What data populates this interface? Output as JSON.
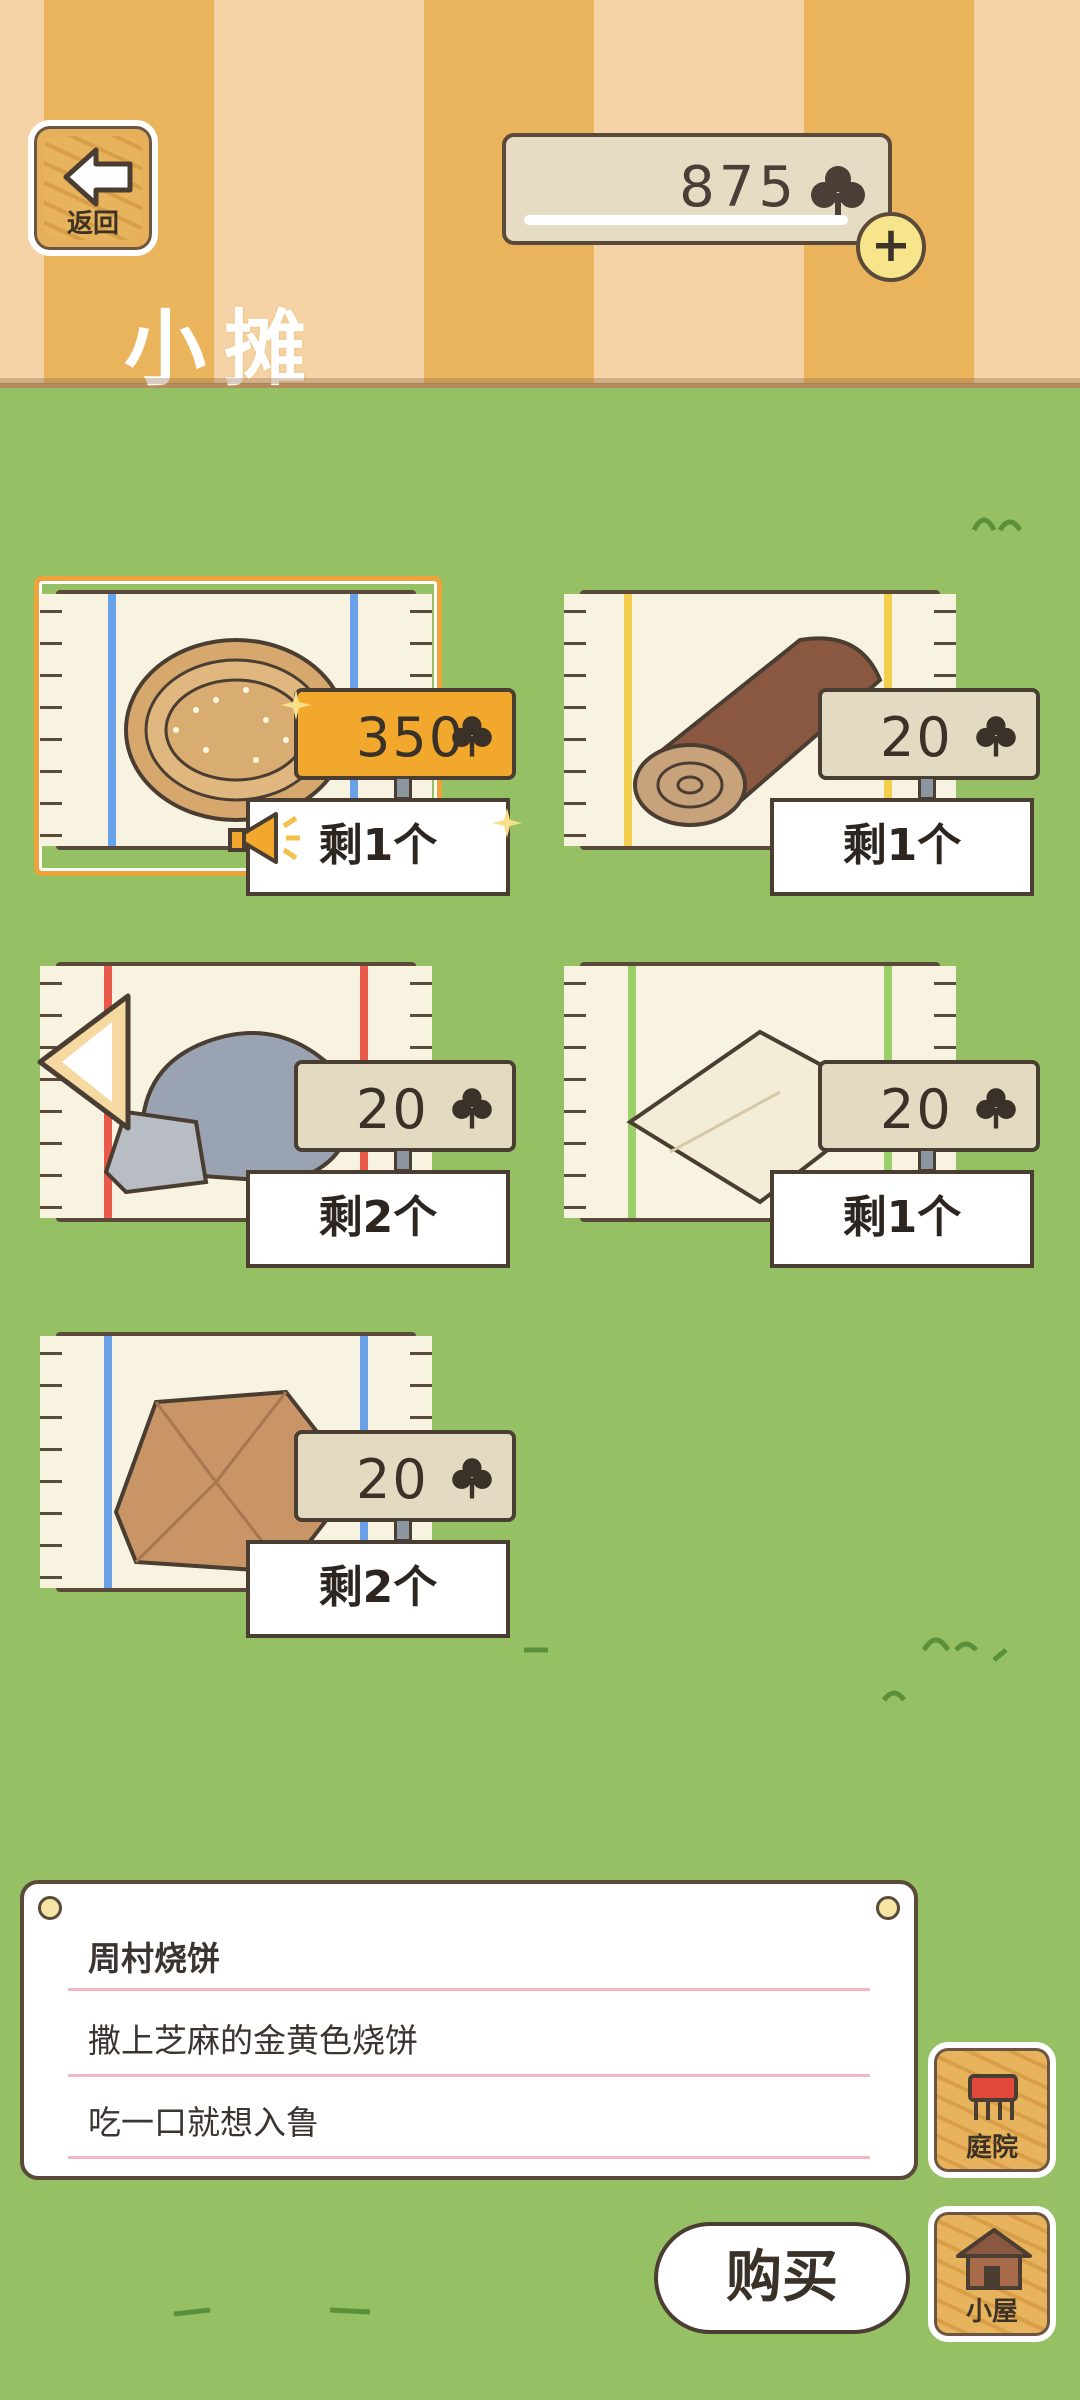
{
  "header": {
    "back_label": "返回",
    "title": "小摊",
    "clover_count": "875"
  },
  "items": [
    {
      "price": "350",
      "remain": "剩1个",
      "selected": true,
      "hot": true,
      "icon": "sesame-pancake-icon"
    },
    {
      "price": "20",
      "remain": "剩1个",
      "selected": false,
      "icon": "log-icon"
    },
    {
      "price": "20",
      "remain": "剩2个",
      "selected": false,
      "icon": "stone-icon"
    },
    {
      "price": "20",
      "remain": "剩1个",
      "selected": false,
      "icon": "cushion-icon"
    },
    {
      "price": "20",
      "remain": "剩2个",
      "selected": false,
      "icon": "paper-bag-icon"
    }
  ],
  "description": {
    "name": "周村烧饼",
    "line1": "撒上芝麻的金黄色烧饼",
    "line2": "吃一口就想入鲁"
  },
  "buttons": {
    "yard_label": "庭院",
    "house_label": "小屋",
    "buy_label": "购买"
  },
  "colors": {
    "grass": "#95c064",
    "stripe_orange": "#e9b45c",
    "stripe_light": "#f5d3a6",
    "hot_price": "#f2a82c"
  }
}
